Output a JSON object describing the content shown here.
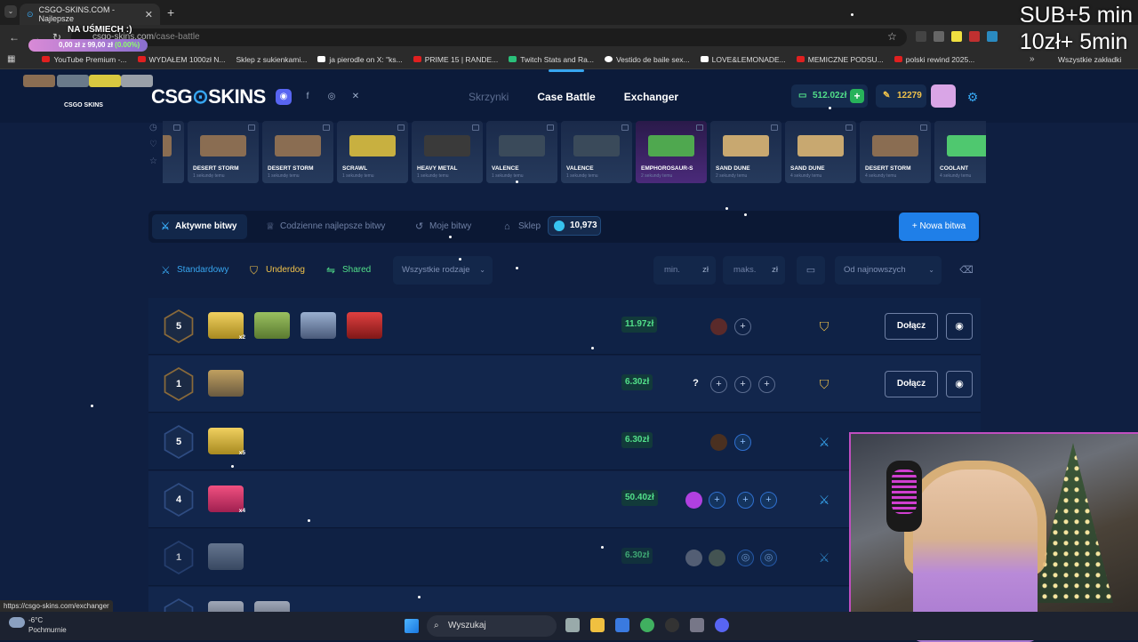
{
  "browser": {
    "tab_title": "CSGO-SKINS.COM - Najlepsze",
    "url_host": "csgo-skins.com",
    "url_path": "/case-battle",
    "bookmarks": [
      "YouTube Premium -...",
      "WYDAŁEM 1000zł N...",
      "Sklep z sukienkami...",
      "ja pierodle on X: \"ks...",
      "PRIME 15 | RANDE...",
      "Twitch Stats and Ra...",
      "Vestido de baile sex...",
      "LOVE&LEMONADE...",
      "MEMICZNE PODSU...",
      "polski rewind 2025..."
    ],
    "bookmarks_all": "Wszystkie zakładki",
    "status_url": "https://csgo-skins.com/exchanger"
  },
  "stream_overlay": {
    "goal_title": "NA UŚMIECH :)",
    "goal_progress_text": "0,00 zł z 99,00 zł",
    "goal_percent": "(0.00%)",
    "goal_percent_value": 0,
    "sub_line_1": "SUB+5 min",
    "sub_line_2": "10zł+ 5min",
    "mini_logo": "CSGO SKINS"
  },
  "site": {
    "logo_left": "CSG",
    "logo_o": "⊙",
    "logo_right": "SKINS",
    "nav": [
      "Skrzynki",
      "Case Battle",
      "Exchanger"
    ],
    "balance": "512.02zł",
    "coins": "12279",
    "live_drops": [
      {
        "name": "",
        "time": "",
        "color": "#8a6d52"
      },
      {
        "name": "DESERT STORM",
        "time": "1 sekundę temu",
        "color": "#8a6d52"
      },
      {
        "name": "DESERT STORM",
        "time": "1 sekundę temu",
        "color": "#8a6d52"
      },
      {
        "name": "SCRAWL",
        "time": "1 sekundę temu",
        "color": "#c8b040"
      },
      {
        "name": "HEAVY METAL",
        "time": "1 sekundę temu",
        "color": "#3a3a3a"
      },
      {
        "name": "VALENCE",
        "time": "1 sekundę temu",
        "color": "#3a4a5a"
      },
      {
        "name": "VALENCE",
        "time": "1 sekundę temu",
        "color": "#3a4a5a"
      },
      {
        "name": "EMPHOROSAUR-S",
        "time": "2 sekundy temu",
        "color": "#4fa84f"
      },
      {
        "name": "SAND DUNE",
        "time": "2 sekundy temu",
        "color": "#c8a870"
      },
      {
        "name": "SAND DUNE",
        "time": "4 sekundy temu",
        "color": "#c8a870"
      },
      {
        "name": "DESERT STORM",
        "time": "4 sekundy temu",
        "color": "#8a6d52"
      },
      {
        "name": "COOLANT",
        "time": "4 sekundy temu",
        "color": "#4fc86f"
      }
    ],
    "tabs": {
      "active": "Aktywne bitwy",
      "daily": "Codzienne najlepsze bitwy",
      "mine": "Moje bitwy",
      "shop": "Sklep",
      "gems": "10,973",
      "new_battle": "Nowa bitwa"
    },
    "filters": {
      "standard": "Standardowy",
      "underdog": "Underdog",
      "shared": "Shared",
      "all_types": "Wszystkie rodzaje",
      "min": "min.",
      "max": "maks.",
      "currency": "zł",
      "sort": "Od najnowszych"
    },
    "battles": [
      {
        "round": "5",
        "price": "11.97zł",
        "join": "Dołącz"
      },
      {
        "round": "1",
        "price": "6.30zł",
        "join": "Dołącz"
      },
      {
        "round": "5",
        "price": "6.30zł"
      },
      {
        "round": "4",
        "price": "50.40zł"
      },
      {
        "round": "1",
        "price": "6.30zł"
      }
    ],
    "case_multipliers": {
      "row1": "x2",
      "row3": "x5",
      "row4": "x4"
    },
    "question_mark": "?"
  },
  "taskbar": {
    "temp": "-6°C",
    "weather": "Pochmurnie",
    "search": "Wyszukaj"
  },
  "colors": {
    "accent": "#37a6f0",
    "green": "#52e08a",
    "gold": "#f0c24a",
    "primary_button": "#1f7fe8"
  }
}
